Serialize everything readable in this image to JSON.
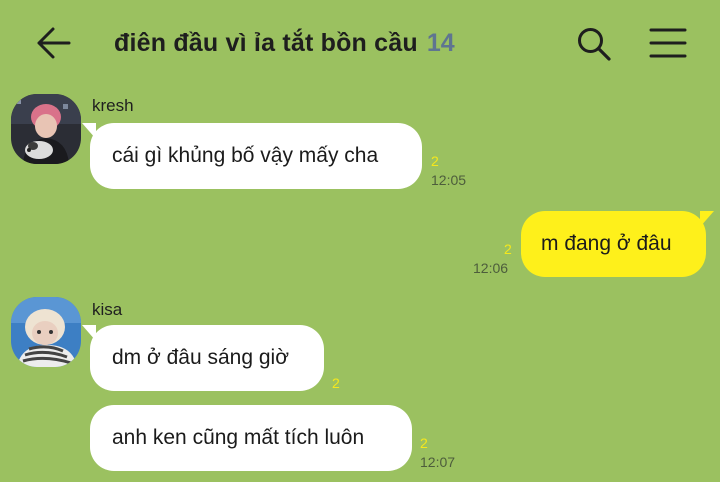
{
  "header": {
    "back_icon": "arrow-left-icon",
    "title": "điên đầu vì ỉa tắt bồn cầu",
    "member_count": "14",
    "search_icon": "search-icon",
    "menu_icon": "hamburger-menu-icon"
  },
  "colors": {
    "background": "#9bc160",
    "incoming_bubble": "#ffffff",
    "outgoing_bubble": "#fef01b",
    "unread_count": "#f5e81c",
    "member_count": "#5f7590"
  },
  "messages": [
    {
      "sender": "kresh",
      "text": "cái gì khủng bố vậy mấy cha",
      "unread": "2",
      "time": "12:05"
    },
    {
      "sender": "",
      "text": "m đang ở đâu",
      "unread": "2",
      "time": "12:06"
    },
    {
      "sender": "kisa",
      "text": "dm ở đâu sáng giờ",
      "unread": "2",
      "time": ""
    },
    {
      "sender": "",
      "text": "anh ken cũng mất tích luôn",
      "unread": "2",
      "time": "12:07"
    }
  ]
}
